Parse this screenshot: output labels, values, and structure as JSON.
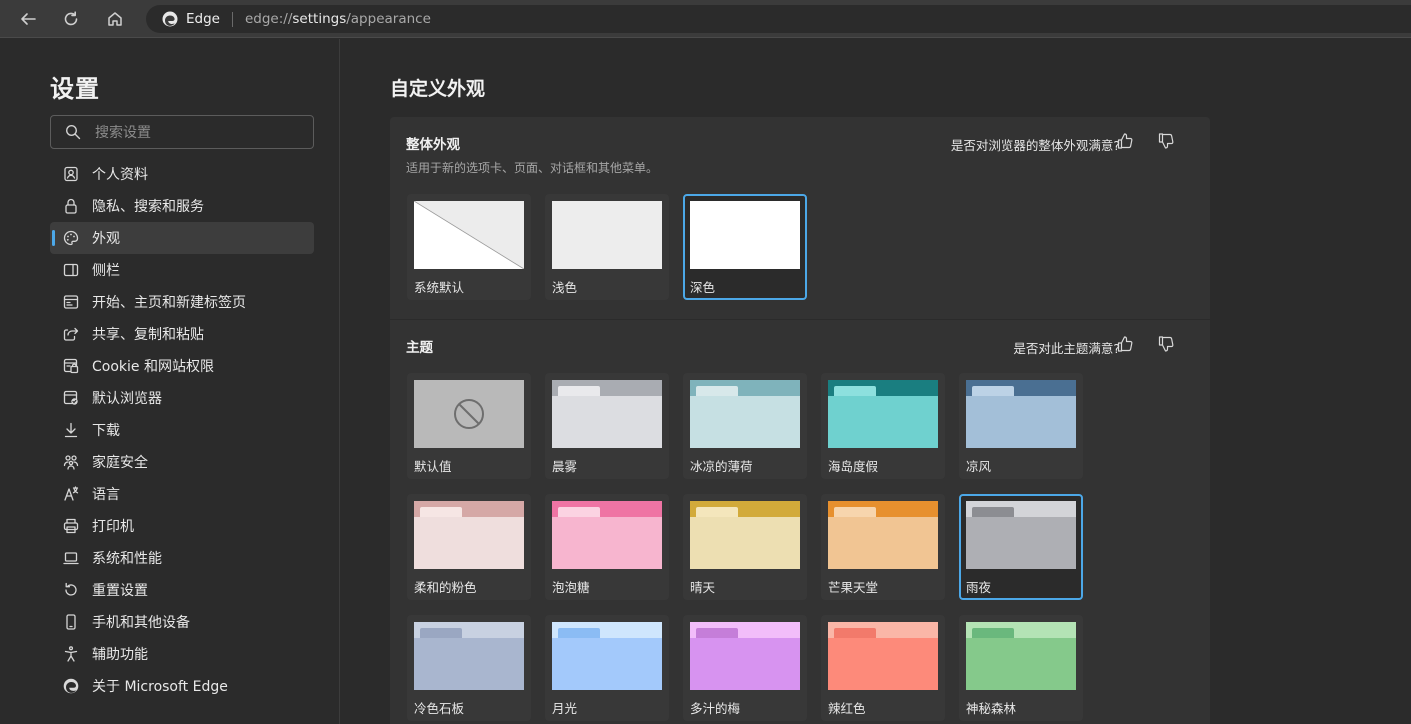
{
  "browser": {
    "brand": "Edge",
    "url_prefix": "edge://",
    "url_strong": "settings",
    "url_suffix": "/appearance"
  },
  "sidebar": {
    "title": "设置",
    "search_placeholder": "搜索设置",
    "items": [
      {
        "label": "个人资料",
        "icon": "profile-icon"
      },
      {
        "label": "隐私、搜索和服务",
        "icon": "lock-icon"
      },
      {
        "label": "外观",
        "icon": "palette-icon",
        "active": true
      },
      {
        "label": "侧栏",
        "icon": "sidebar-icon"
      },
      {
        "label": "开始、主页和新建标签页",
        "icon": "home-page-icon"
      },
      {
        "label": "共享、复制和粘贴",
        "icon": "share-icon"
      },
      {
        "label": "Cookie 和网站权限",
        "icon": "site-permissions-icon"
      },
      {
        "label": "默认浏览器",
        "icon": "default-browser-icon"
      },
      {
        "label": "下载",
        "icon": "download-icon"
      },
      {
        "label": "家庭安全",
        "icon": "family-icon"
      },
      {
        "label": "语言",
        "icon": "language-icon"
      },
      {
        "label": "打印机",
        "icon": "printer-icon"
      },
      {
        "label": "系统和性能",
        "icon": "laptop-icon"
      },
      {
        "label": "重置设置",
        "icon": "reset-icon"
      },
      {
        "label": "手机和其他设备",
        "icon": "phone-icon"
      },
      {
        "label": "辅助功能",
        "icon": "accessibility-icon"
      },
      {
        "label": "关于 Microsoft Edge",
        "icon": "edge-logo-icon"
      }
    ]
  },
  "main": {
    "title": "自定义外观",
    "overall": {
      "title": "整体外观",
      "subtitle": "适用于新的选项卡、页面、对话框和其他菜单。",
      "feedback": "是否对浏览器的整体外观满意?",
      "options": [
        {
          "label": "系统默认",
          "kind": "system"
        },
        {
          "label": "浅色",
          "kind": "light"
        },
        {
          "label": "深色",
          "kind": "dark",
          "selected": true
        }
      ]
    },
    "themes": {
      "title": "主题",
      "feedback": "是否对此主题满意?",
      "items": [
        {
          "label": "默认值",
          "kind": "default"
        },
        {
          "label": "晨雾",
          "top": "#a9acb2",
          "tab": "#e9e9ec",
          "body": "#dcdde1"
        },
        {
          "label": "冰凉的薄荷",
          "top": "#7fb3bb",
          "tab": "#d7e8ea",
          "body": "#c6e0e3"
        },
        {
          "label": "海岛度假",
          "top": "#1a7e80",
          "tab": "#8de0de",
          "body": "#6fd1cf"
        },
        {
          "label": "凉风",
          "top": "#4a6f92",
          "tab": "#bcd2e6",
          "body": "#a3bfd8"
        },
        {
          "label": "柔和的粉色",
          "top": "#d5a8a6",
          "tab": "#f6e6e4",
          "body": "#efdedd"
        },
        {
          "label": "泡泡糖",
          "top": "#ef74a4",
          "tab": "#fbd3e2",
          "body": "#f7b5cf"
        },
        {
          "label": "晴天",
          "top": "#d2aa3a",
          "tab": "#f4e6bc",
          "body": "#eddfb2"
        },
        {
          "label": "芒果天堂",
          "top": "#e7902e",
          "tab": "#f7d5ad",
          "body": "#f1c593"
        },
        {
          "label": "雨夜",
          "top": "#d3d4d8",
          "tab": "#8c8d92",
          "body": "#aeafb4",
          "selected": true
        },
        {
          "label": "冷色石板",
          "top": "#c8d1e1",
          "tab": "#9aa7c2",
          "body": "#a9b6cf"
        },
        {
          "label": "月光",
          "top": "#cfe6fd",
          "tab": "#8bbcf4",
          "body": "#a3c9fb"
        },
        {
          "label": "多汁的梅",
          "top": "#f2bdfa",
          "tab": "#c57ed9",
          "body": "#d793f0"
        },
        {
          "label": "辣红色",
          "top": "#fab6a7",
          "tab": "#f27a6b",
          "body": "#fd8a7a"
        },
        {
          "label": "神秘森林",
          "top": "#b4e3b5",
          "tab": "#6ab87d",
          "body": "#85c98b"
        }
      ]
    }
  },
  "colors": {
    "accent": "#4ca8e8",
    "page_bg": "#2b2b2b",
    "card_bg": "#333333"
  }
}
